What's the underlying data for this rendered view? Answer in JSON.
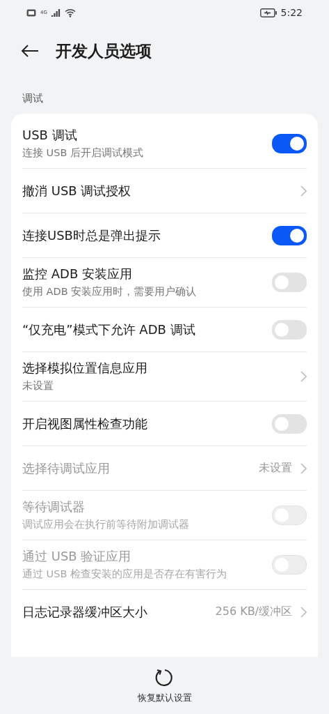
{
  "status_bar": {
    "network": "4G",
    "time": "5:22"
  },
  "header": {
    "title": "开发人员选项"
  },
  "section": {
    "label": "调试"
  },
  "rows": [
    {
      "kind": "toggle",
      "title": "USB 调试",
      "subtitle": "连接 USB 后开启调试模式",
      "on": true,
      "disabled": false
    },
    {
      "kind": "link",
      "title": "撤消 USB 调试授权",
      "disabled": false
    },
    {
      "kind": "toggle",
      "title": "连接USB时总是弹出提示",
      "on": true,
      "disabled": false
    },
    {
      "kind": "toggle",
      "title": "监控 ADB 安装应用",
      "subtitle": "使用 ADB 安装应用时，需要用户确认",
      "on": false,
      "disabled": false
    },
    {
      "kind": "toggle",
      "title": "“仅充电”模式下允许 ADB 调试",
      "on": false,
      "disabled": false
    },
    {
      "kind": "link",
      "title": "选择模拟位置信息应用",
      "subtitle": "未设置",
      "disabled": false
    },
    {
      "kind": "toggle",
      "title": "开启视图属性检查功能",
      "on": false,
      "disabled": false
    },
    {
      "kind": "link",
      "title": "选择待调试应用",
      "value": "未设置",
      "disabled": true
    },
    {
      "kind": "toggle",
      "title": "等待调试器",
      "subtitle": "调试应用会在执行前等待附加调试器",
      "on": false,
      "disabled": true
    },
    {
      "kind": "toggle",
      "title": "通过 USB 验证应用",
      "subtitle": "通过 USB 检查安装的应用是否存在有害行为",
      "on": false,
      "disabled": true
    },
    {
      "kind": "link",
      "title": "日志记录器缓冲区大小",
      "value": "256 KB/缓冲区",
      "disabled": false
    }
  ],
  "footer": {
    "reset_label": "恢复默认设置"
  }
}
